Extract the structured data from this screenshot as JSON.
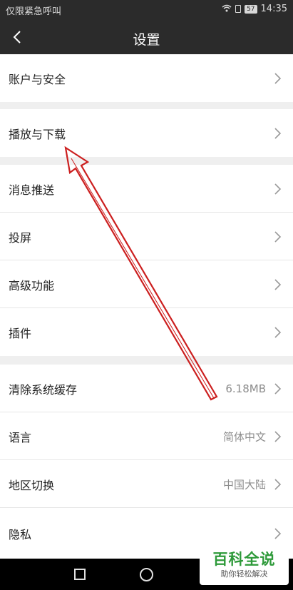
{
  "status_bar": {
    "left_text": "仅限紧急呼叫",
    "battery": "57",
    "time": "14:35"
  },
  "header": {
    "title": "设置"
  },
  "items": [
    {
      "label": "账户与安全",
      "value": ""
    },
    {
      "label": "播放与下载",
      "value": ""
    },
    {
      "label": "消息推送",
      "value": ""
    },
    {
      "label": "投屏",
      "value": ""
    },
    {
      "label": "高级功能",
      "value": ""
    },
    {
      "label": "插件",
      "value": ""
    },
    {
      "label": "清除系统缓存",
      "value": "6.18MB"
    },
    {
      "label": "语言",
      "value": "简体中文"
    },
    {
      "label": "地区切换",
      "value": "中国大陆"
    },
    {
      "label": "隐私",
      "value": ""
    }
  ],
  "watermark": {
    "title": "百科全说",
    "subtitle": "助你轻松解决"
  },
  "colors": {
    "header_bg": "#2b2b2b",
    "page_bg": "#efefef",
    "arrow": "#cc1f1f",
    "watermark_green": "#2e9a3a"
  },
  "icons": [
    "back-icon",
    "chevron-right-icon",
    "wifi-icon",
    "battery-icon",
    "nav-square-icon",
    "nav-home-icon"
  ]
}
